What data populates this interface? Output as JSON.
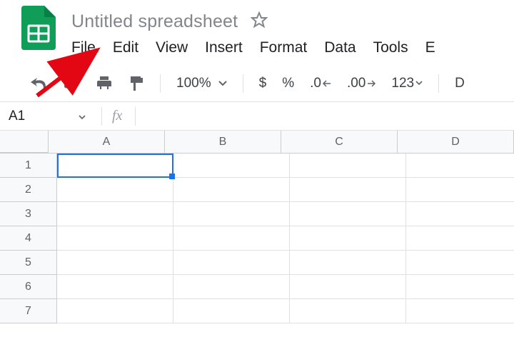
{
  "title": "Untitled spreadsheet",
  "menu": [
    "File",
    "Edit",
    "View",
    "Insert",
    "Format",
    "Data",
    "Tools",
    "E"
  ],
  "toolbar": {
    "zoom": "100%",
    "currency_label": "$",
    "percent_label": "%",
    "dec_less": ".0",
    "dec_more": ".00",
    "more_formats": "123",
    "default_font_initial": "D"
  },
  "active_cell": "A1",
  "fx_label": "fx",
  "columns": [
    "A",
    "B",
    "C",
    "D"
  ],
  "rows": [
    "1",
    "2",
    "3",
    "4",
    "5",
    "6",
    "7"
  ]
}
